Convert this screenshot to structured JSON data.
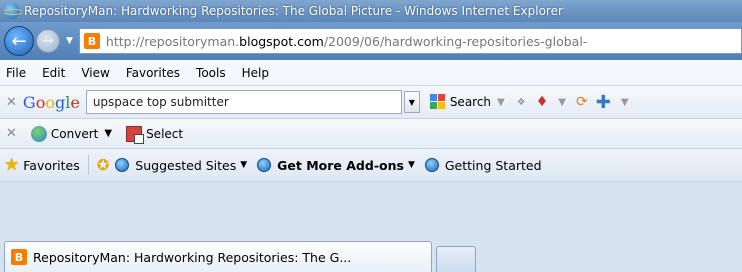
{
  "window": {
    "title": "RepositoryMan: Hardworking Repositories: The Global Picture - Windows Internet Explorer"
  },
  "address_bar": {
    "url_prefix": "http://repositoryman.",
    "url_domain": "blogspot.com",
    "url_path": "/2009/06/hardworking-repositories-global-"
  },
  "menu": {
    "items": [
      "File",
      "Edit",
      "View",
      "Favorites",
      "Tools",
      "Help"
    ]
  },
  "google_toolbar": {
    "logo": "Google",
    "search_value": "upspace top submitter",
    "search_button": "Search"
  },
  "convert_toolbar": {
    "convert_label": "Convert",
    "select_label": "Select"
  },
  "favorites_bar": {
    "favorites_label": "Favorites",
    "links": [
      "Suggested Sites",
      "Get More Add-ons",
      "Getting Started"
    ]
  },
  "tabs": {
    "active_tab": "RepositoryMan: Hardworking Repositories: The G..."
  },
  "colors": {
    "titlebar": "#5d86b8",
    "blogger_orange": "#f57d00"
  }
}
